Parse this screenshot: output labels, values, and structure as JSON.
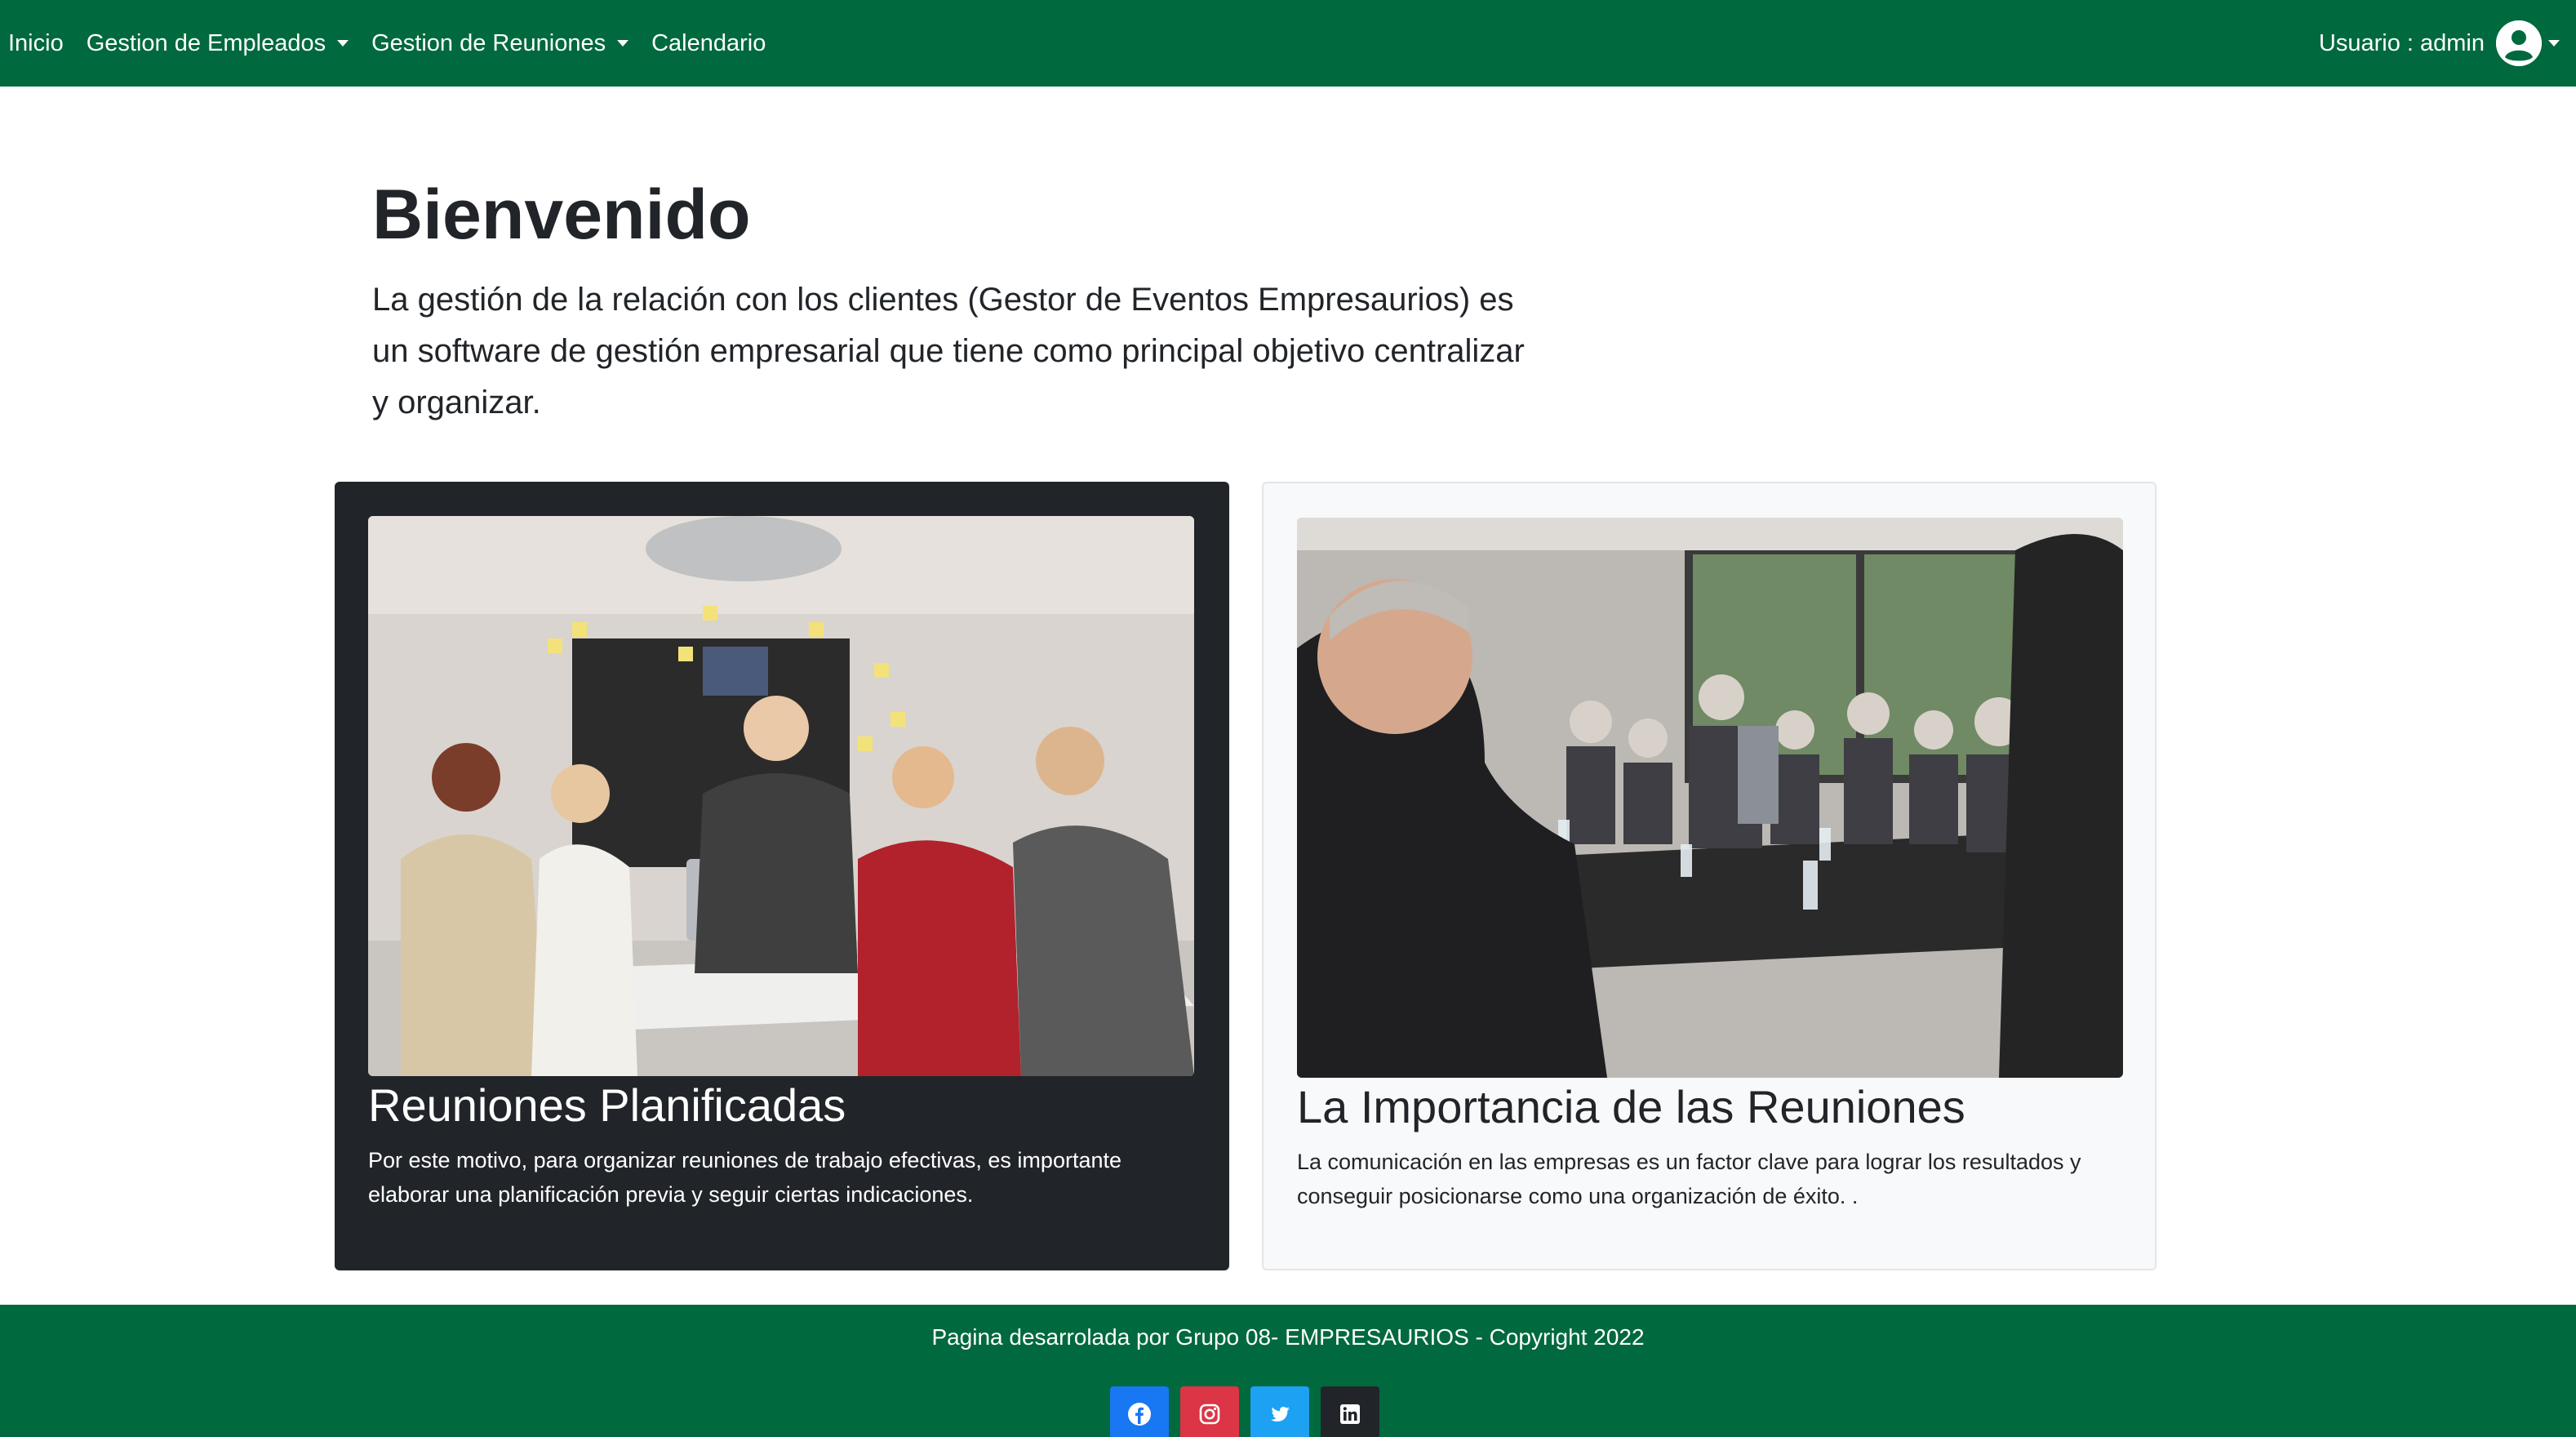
{
  "navbar": {
    "items": [
      {
        "label": "Inicio",
        "has_dropdown": false
      },
      {
        "label": "Gestion de Empleados",
        "has_dropdown": true
      },
      {
        "label": "Gestion de Reuniones",
        "has_dropdown": true
      },
      {
        "label": "Calendario",
        "has_dropdown": false
      }
    ],
    "user_label": "Usuario : admin",
    "user_icon": "user-circle-icon"
  },
  "hero": {
    "title": "Bienvenido",
    "text": "La gestión de la relación con los clientes (Gestor de Eventos Empresaurios) es un software de gestión empresarial que tiene como principal objetivo centralizar y organizar."
  },
  "cards": [
    {
      "title": "Reuniones Planificadas",
      "text": "Por este motivo, para organizar reuniones de trabajo efectivas, es importante elaborar una planificación previa y seguir ciertas indicaciones.",
      "image": "team-meeting-photo",
      "theme": "dark"
    },
    {
      "title": "La Importancia de las Reuniones",
      "text": "La comunicación en las empresas es un factor clave para lograr los resultados y conseguir posicionarse como una organización de éxito. .",
      "image": "conference-room-photo",
      "theme": "light"
    }
  ],
  "footer": {
    "text": "Pagina desarrolada por Grupo 08- EMPRESAURIOS - Copyright 2022",
    "socials": [
      {
        "name": "facebook",
        "icon": "facebook-icon",
        "color": "#1877f2"
      },
      {
        "name": "instagram",
        "icon": "instagram-icon",
        "color": "#dc3545"
      },
      {
        "name": "twitter",
        "icon": "twitter-icon",
        "color": "#1da1f2"
      },
      {
        "name": "linkedin",
        "icon": "linkedin-icon",
        "color": "#212529"
      }
    ]
  },
  "colors": {
    "brand_green": "#00693e",
    "dark_card": "#212529",
    "light_card": "#f8f9fa"
  }
}
